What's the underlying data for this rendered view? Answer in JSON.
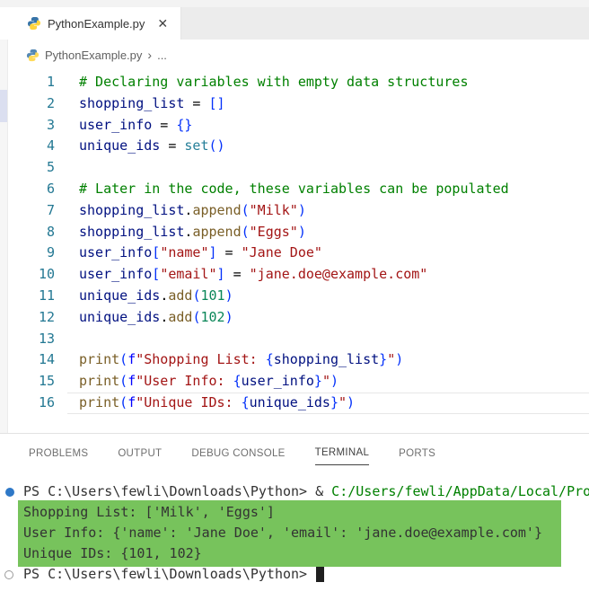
{
  "tab": {
    "title": "PythonExample.py",
    "close_glyph": "✕"
  },
  "breadcrumb": {
    "file": "PythonExample.py",
    "separator": "›",
    "ellipsis": "..."
  },
  "colors": {
    "tab_bar_bg": "#ececec",
    "comment": "#008000",
    "variable": "#001080",
    "function": "#795e26",
    "string": "#a31515",
    "number": "#098658",
    "fstring_prefix": "#0000ff",
    "bracket": "#0431fa",
    "builtin_type": "#267f99",
    "line_number": "#237893",
    "terminal_highlight_bg": "#77c35c",
    "terminal_command_path": "#008000",
    "command_marker_blue": "#2e78c7"
  },
  "editor": {
    "lines": [
      {
        "n": 1,
        "tokens": [
          [
            "# Declaring variables with empty data structures",
            "com"
          ]
        ]
      },
      {
        "n": 2,
        "tokens": [
          [
            "shopping_list",
            "var"
          ],
          [
            " = ",
            "pun"
          ],
          [
            "[]",
            "brk"
          ]
        ]
      },
      {
        "n": 3,
        "tokens": [
          [
            "user_info",
            "var"
          ],
          [
            " = ",
            "pun"
          ],
          [
            "{}",
            "brk"
          ]
        ]
      },
      {
        "n": 4,
        "tokens": [
          [
            "unique_ids",
            "var"
          ],
          [
            " = ",
            "pun"
          ],
          [
            "set",
            "type"
          ],
          [
            "()",
            "brk"
          ]
        ]
      },
      {
        "n": 5,
        "tokens": []
      },
      {
        "n": 6,
        "tokens": [
          [
            "# Later in the code, these variables can be populated",
            "com"
          ]
        ]
      },
      {
        "n": 7,
        "tokens": [
          [
            "shopping_list",
            "var"
          ],
          [
            ".",
            "pun"
          ],
          [
            "append",
            "fn"
          ],
          [
            "(",
            "brk"
          ],
          [
            "\"Milk\"",
            "str"
          ],
          [
            ")",
            "brk"
          ]
        ]
      },
      {
        "n": 8,
        "tokens": [
          [
            "shopping_list",
            "var"
          ],
          [
            ".",
            "pun"
          ],
          [
            "append",
            "fn"
          ],
          [
            "(",
            "brk"
          ],
          [
            "\"Eggs\"",
            "str"
          ],
          [
            ")",
            "brk"
          ]
        ]
      },
      {
        "n": 9,
        "tokens": [
          [
            "user_info",
            "var"
          ],
          [
            "[",
            "brk"
          ],
          [
            "\"name\"",
            "str"
          ],
          [
            "]",
            "brk"
          ],
          [
            " = ",
            "pun"
          ],
          [
            "\"Jane Doe\"",
            "str"
          ]
        ]
      },
      {
        "n": 10,
        "tokens": [
          [
            "user_info",
            "var"
          ],
          [
            "[",
            "brk"
          ],
          [
            "\"email\"",
            "str"
          ],
          [
            "]",
            "brk"
          ],
          [
            " = ",
            "pun"
          ],
          [
            "\"jane.doe@example.com\"",
            "str"
          ]
        ]
      },
      {
        "n": 11,
        "tokens": [
          [
            "unique_ids",
            "var"
          ],
          [
            ".",
            "pun"
          ],
          [
            "add",
            "fn"
          ],
          [
            "(",
            "brk"
          ],
          [
            "101",
            "num"
          ],
          [
            ")",
            "brk"
          ]
        ]
      },
      {
        "n": 12,
        "tokens": [
          [
            "unique_ids",
            "var"
          ],
          [
            ".",
            "pun"
          ],
          [
            "add",
            "fn"
          ],
          [
            "(",
            "brk"
          ],
          [
            "102",
            "num"
          ],
          [
            ")",
            "brk"
          ]
        ]
      },
      {
        "n": 13,
        "tokens": []
      },
      {
        "n": 14,
        "tokens": [
          [
            "print",
            "fn"
          ],
          [
            "(",
            "brk"
          ],
          [
            "f",
            "kw"
          ],
          [
            "\"Shopping List: ",
            "str"
          ],
          [
            "{",
            "brk"
          ],
          [
            "shopping_list",
            "var"
          ],
          [
            "}",
            "brk"
          ],
          [
            "\"",
            "str"
          ],
          [
            ")",
            "brk"
          ]
        ]
      },
      {
        "n": 15,
        "tokens": [
          [
            "print",
            "fn"
          ],
          [
            "(",
            "brk"
          ],
          [
            "f",
            "kw"
          ],
          [
            "\"User Info: ",
            "str"
          ],
          [
            "{",
            "brk"
          ],
          [
            "user_info",
            "var"
          ],
          [
            "}",
            "brk"
          ],
          [
            "\"",
            "str"
          ],
          [
            ")",
            "brk"
          ]
        ]
      },
      {
        "n": 16,
        "current": true,
        "tokens": [
          [
            "print",
            "fn"
          ],
          [
            "(",
            "brk"
          ],
          [
            "f",
            "kw"
          ],
          [
            "\"Unique IDs: ",
            "str"
          ],
          [
            "{",
            "brk"
          ],
          [
            "unique_ids",
            "var"
          ],
          [
            "}",
            "brk"
          ],
          [
            "\"",
            "str"
          ],
          [
            ")",
            "brk"
          ]
        ]
      }
    ]
  },
  "panel": {
    "tabs": [
      {
        "label": "PROBLEMS"
      },
      {
        "label": "OUTPUT"
      },
      {
        "label": "DEBUG CONSOLE"
      },
      {
        "label": "TERMINAL",
        "active": true
      },
      {
        "label": "PORTS"
      }
    ]
  },
  "terminal": {
    "lines": [
      {
        "marker": "blue-dot",
        "tokens": [
          [
            "PS C:\\Users\\fewli\\Downloads\\Python> & ",
            "fg"
          ],
          [
            "C:/Users/fewli/AppData/Local/Pro",
            "grn"
          ]
        ]
      },
      {
        "hl": true,
        "tokens": [
          [
            "Shopping List: ['Milk', 'Eggs']",
            "fg"
          ]
        ]
      },
      {
        "hl": true,
        "tokens": [
          [
            "User Info: {'name': 'Jane Doe', 'email': 'jane.doe@example.com'}",
            "fg"
          ]
        ]
      },
      {
        "hl": true,
        "tokens": [
          [
            "Unique IDs: {101, 102}",
            "fg"
          ]
        ]
      },
      {
        "marker": "hollow-circle",
        "cursor": true,
        "tokens": [
          [
            "PS C:\\Users\\fewli\\Downloads\\Python> ",
            "fg"
          ]
        ]
      }
    ]
  }
}
